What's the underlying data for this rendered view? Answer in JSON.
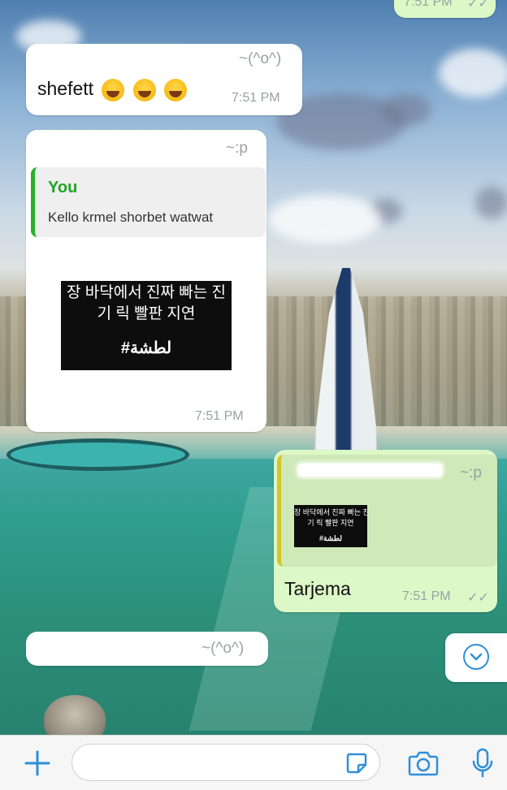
{
  "top_partial_bubble": {
    "time": "7:51 PM",
    "ticks": "✓✓"
  },
  "messages": [
    {
      "id": "m1",
      "direction": "incoming",
      "sender_phone_suffix": "~(^o^)",
      "text": "shefett",
      "emoji": [
        "face-with-tears-of-joy",
        "face-with-tears-of-joy",
        "face-with-tears-of-joy"
      ],
      "time": "7:51 PM"
    },
    {
      "id": "m2",
      "direction": "incoming",
      "sender_phone_suffix": "~:p",
      "quote": {
        "author": "You",
        "text": "Kello krmel shorbet watwat"
      },
      "media": {
        "korean_line_1": "장 바닥에서 진짜 빠는 진",
        "korean_line_2": "기 릭 빨판 지연",
        "hashtag": "#لطشة"
      },
      "time": "7:51 PM"
    },
    {
      "id": "m3",
      "direction": "outgoing",
      "quote": {
        "sender_phone_suffix": "~:p",
        "media": {
          "korean_line_1": "장 바닥에서 진짜 빠는 진",
          "korean_line_2": "기 릭 빨판 지연",
          "hashtag": "#لطشة"
        }
      },
      "text": "Tarjema",
      "time": "7:51 PM",
      "ticks": "✓✓"
    },
    {
      "id": "m4",
      "direction": "incoming",
      "sender_phone_suffix": "~(^o^)"
    }
  ],
  "input_bar": {
    "placeholder": ""
  },
  "colors": {
    "outgoing_bubble": "#dcf8c6",
    "incoming_bubble": "#ffffff",
    "quote_bar_green": "#25b329",
    "quote_bar_yellow": "#d6c52a",
    "accent_blue": "#2e8fd8"
  },
  "icons": {
    "attach": "plus-icon",
    "sticker": "sticker-icon",
    "camera": "camera-icon",
    "mic": "microphone-icon",
    "scroll": "chevron-down-icon"
  }
}
